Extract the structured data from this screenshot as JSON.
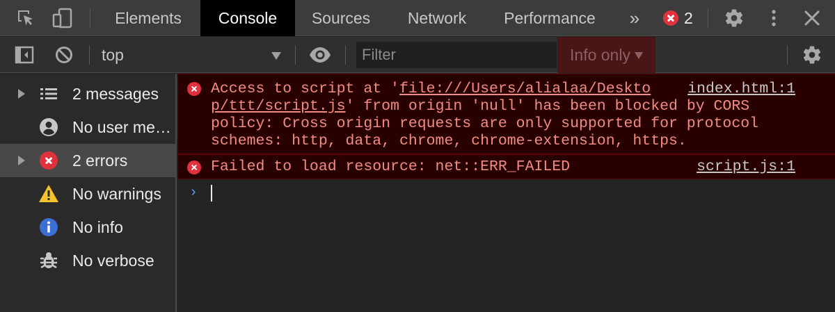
{
  "tabs": [
    "Elements",
    "Console",
    "Sources",
    "Network",
    "Performance"
  ],
  "tabs_overflow": "»",
  "error_count": "2",
  "toolbar": {
    "context": "top",
    "filter_placeholder": "Filter",
    "levels": "Info only"
  },
  "sidebar": {
    "items": [
      {
        "label": "2 messages",
        "icon": "list-icon"
      },
      {
        "label": "No user me…",
        "icon": "user-icon"
      },
      {
        "label": "2 errors",
        "icon": "error-icon"
      },
      {
        "label": "No warnings",
        "icon": "warning-icon"
      },
      {
        "label": "No info",
        "icon": "info-icon"
      },
      {
        "label": "No verbose",
        "icon": "bug-icon"
      }
    ]
  },
  "console": {
    "messages": [
      {
        "line1_pre": "Access to script at '",
        "line1_link": "file:///Users/alialaa/Deskto",
        "line2_link": "p/ttt/script.js",
        "line2_post": "' from origin 'null' has been blocked by CORS",
        "line3": "policy: Cross origin requests are only supported for protocol",
        "line4": "schemes: http, data, chrome, chrome-extension, https.",
        "source": "index.html:1"
      },
      {
        "text": "Failed to load resource: net::ERR_FAILED",
        "source": "script.js:1"
      }
    ],
    "prompt": "›"
  },
  "colors": {
    "error_red": "#e0323c",
    "error_text": "#f28b82",
    "error_bg": "#290000",
    "accent_blue": "#5aa0ff"
  }
}
